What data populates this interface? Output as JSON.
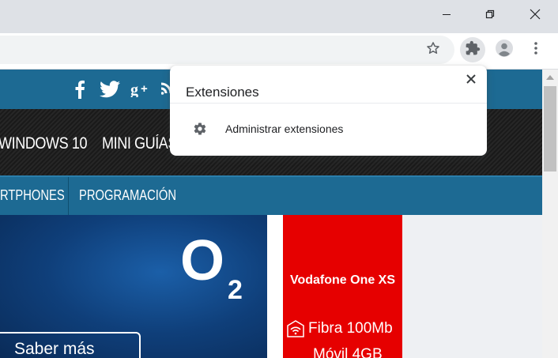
{
  "browser": {
    "toolbar": {
      "bookmark_icon": "star-icon",
      "extensions_icon": "puzzle-icon",
      "profile_icon": "avatar-icon",
      "menu_icon": "kebab-menu-icon"
    },
    "window_controls": {
      "minimize_icon": "minimize-icon",
      "restore_icon": "restore-icon",
      "close_icon": "close-icon"
    }
  },
  "extensions_popup": {
    "title": "Extensiones",
    "close_icon": "close-icon",
    "items": [
      {
        "icon": "gear-icon",
        "label": "Administrar extensiones"
      }
    ]
  },
  "website": {
    "social_icons": [
      "facebook-icon",
      "twitter-icon",
      "google-plus-icon",
      "rss-icon"
    ],
    "nav": {
      "items": [
        "WINDOWS 10",
        "MINI GUÍAS"
      ]
    },
    "subnav": {
      "items": [
        "RTPHONES",
        "PROGRAMACIÓN"
      ]
    },
    "hero_ad": {
      "brand": "O",
      "brand_sub": "2",
      "cta": "Saber más"
    },
    "side_ad": {
      "title": "Vodafone One XS",
      "line1": "Fibra 100Mb",
      "line2": "Móvil 4GB"
    }
  },
  "colors": {
    "site_blue": "#1d6a93",
    "ad_red": "#e60000",
    "hero_blue": "#0f3f7a",
    "chrome_frame": "#dee1e6"
  }
}
